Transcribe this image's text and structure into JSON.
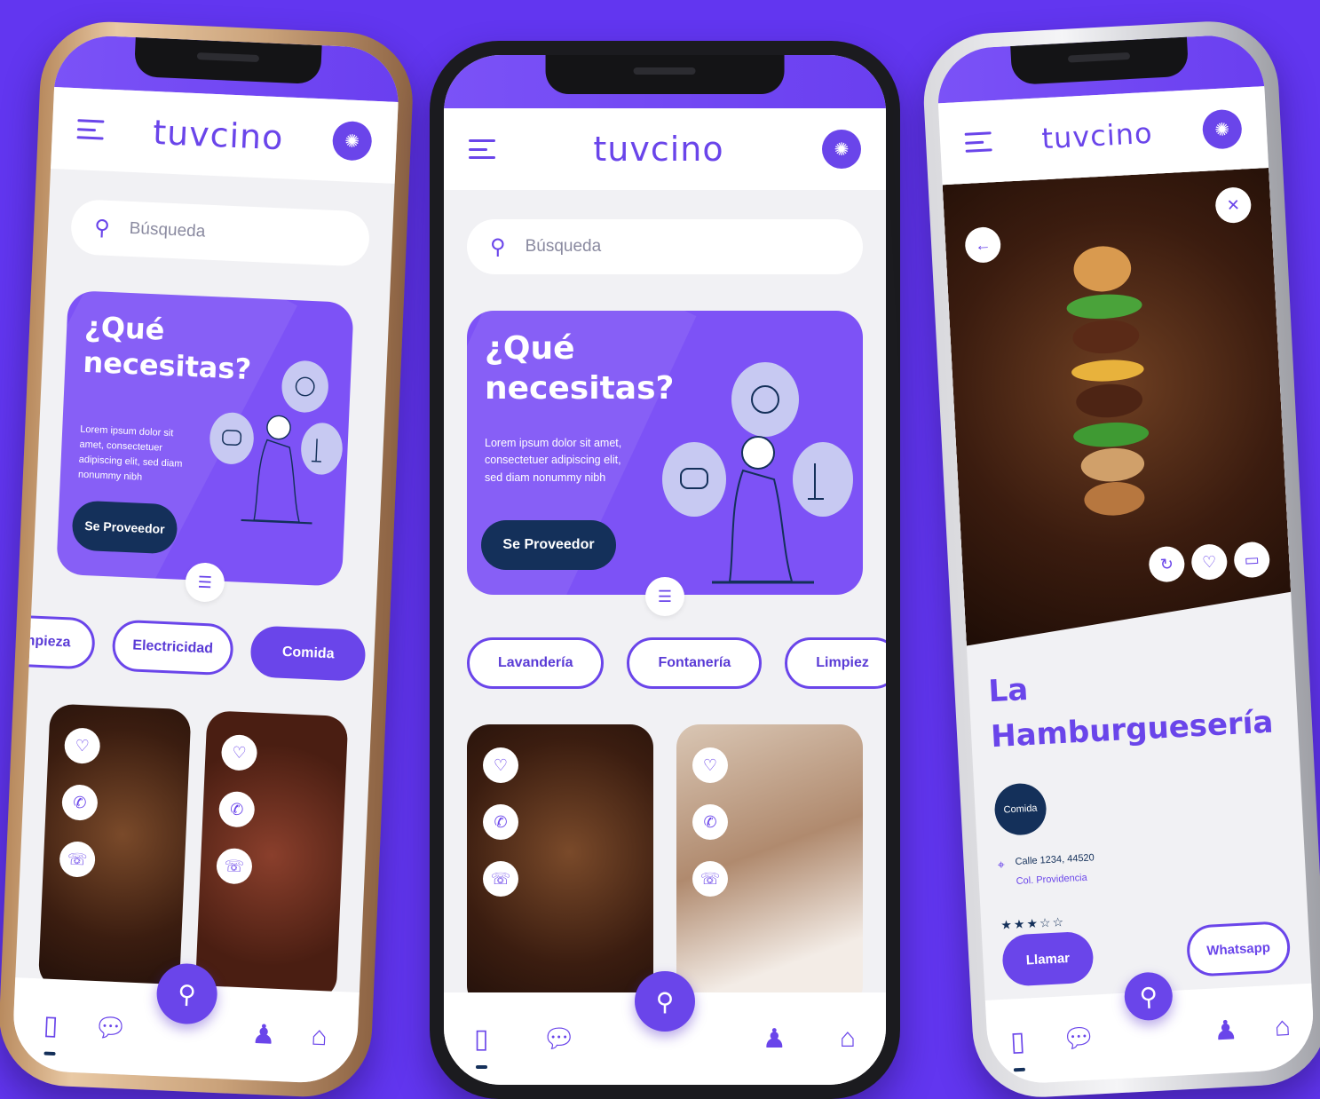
{
  "app": {
    "logo": "tuvcino",
    "search_placeholder": "Búsqueda"
  },
  "banner": {
    "title": "¿Qué necesitas?",
    "body": "Lorem ipsum dolor sit amet, consectetuer adipiscing elit, sed diam nonummy nibh",
    "button": "Se Proveedor"
  },
  "left_phone": {
    "chips": [
      "impieza",
      "Electricidad",
      "Comida"
    ],
    "active_chip": "Comida"
  },
  "center_phone": {
    "chips": [
      "Lavandería",
      "Fontanería",
      "Limpiez"
    ]
  },
  "detail": {
    "title": "La Hamburguesería",
    "tag": "Comida",
    "address_line1": "Calle 1234, 44520",
    "address_line2": "Col. Providencia",
    "rating_stars": 3,
    "rating_max": 5,
    "call_button": "Llamar",
    "whatsapp_button": "Whatsapp"
  },
  "icons": {
    "menu": "menu-icon",
    "alert": "alarm-icon",
    "search": "search-icon",
    "list": "list-icon",
    "heart": "heart-icon",
    "whatsapp": "whatsapp-icon",
    "phone": "phone-icon",
    "nav": [
      "notebook-icon",
      "chat-icon",
      "community-icon",
      "home-icon"
    ]
  },
  "colors": {
    "background": "#6236f0",
    "primary": "#6a45ea",
    "navy": "#14305a",
    "surface": "#f1f1f4"
  }
}
